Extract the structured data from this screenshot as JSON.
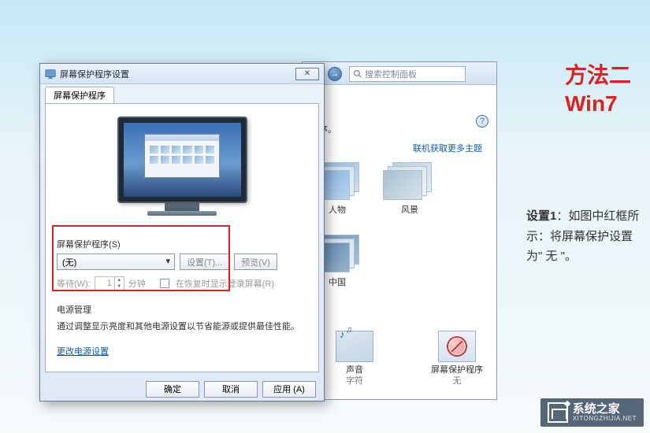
{
  "annotation": {
    "title_line1": "方法二",
    "title_line2": "Win7",
    "step_label": "设置1",
    "body": "：如图中红框所示：将屏幕保护设置为\" 无 \"。"
  },
  "back_window": {
    "search_placeholder": "搜索控制面板",
    "body_text": "程序。",
    "link_more_themes": "联机获取更多主题",
    "thumbs": {
      "t1": "人物",
      "t2": "风景",
      "t3": "中国"
    },
    "icons": {
      "sound_label": "声音",
      "sound_sub": "字符",
      "ss_label": "屏幕保护程序",
      "ss_sub": "无"
    }
  },
  "dialog": {
    "title": "屏幕保护程序设置",
    "tab": "屏幕保护程序",
    "section_label": "屏幕保护程序(S)",
    "combo_value": "(无)",
    "btn_settings": "设置(T)...",
    "btn_preview": "预览(V)",
    "wait_label": "等待(W):",
    "wait_value": "1",
    "wait_unit": "分钟",
    "checkbox_label": "在恢复时显示登录屏幕(R)",
    "pm_label": "电源管理",
    "pm_desc": "通过调整显示亮度和其他电源设置以节省能源或提供最佳性能。",
    "pm_link": "更改电源设置",
    "btn_ok": "确定",
    "btn_cancel": "取消",
    "btn_apply": "应用 (A)"
  },
  "watermark": {
    "name": "系统之家",
    "url": "XITONGZHIJIA.NET"
  }
}
